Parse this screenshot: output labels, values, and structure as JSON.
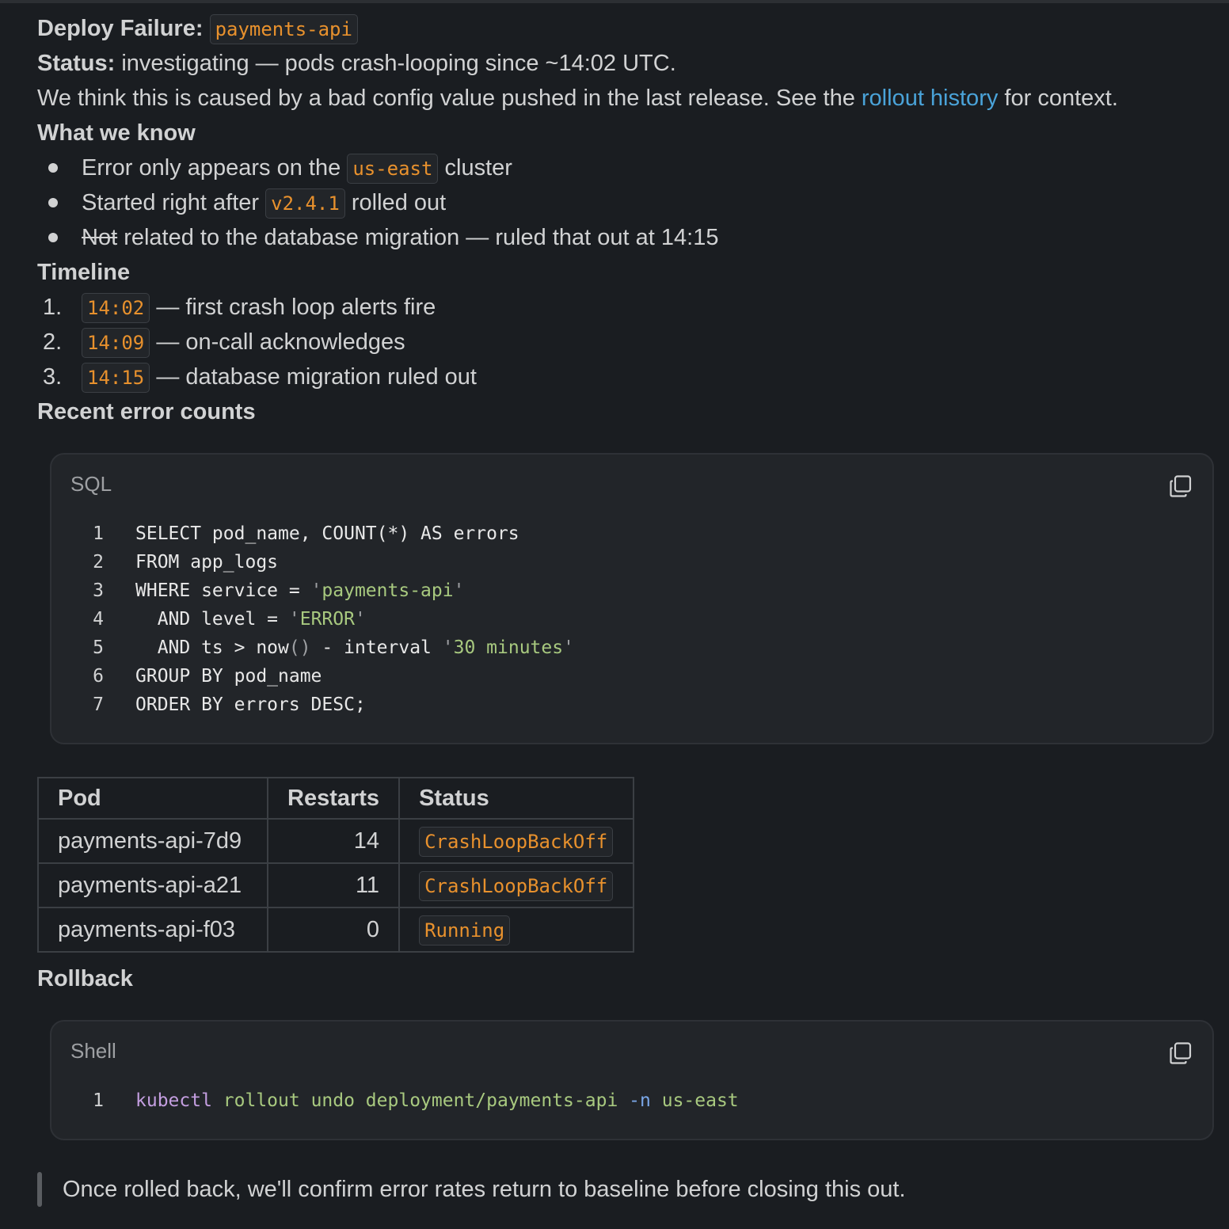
{
  "title": {
    "label": "Deploy Failure:",
    "service": "payments-api"
  },
  "status": {
    "label": "Status:",
    "text": "investigating — pods crash-looping since ~14:02 UTC."
  },
  "intro": {
    "before": "We think this is caused by a bad config value pushed in the last release. See the",
    "link": "rollout history",
    "after": "for context."
  },
  "what_we_know": {
    "heading": "What we know",
    "items": [
      {
        "before": "Error only appears on the",
        "code": "us-east",
        "after": "cluster"
      },
      {
        "before": "Started right after",
        "code": "v2.4.1",
        "after": "rolled out"
      },
      {
        "strike": "Not",
        "after": "related to the database migration — ruled that out at 14:15"
      }
    ]
  },
  "timeline": {
    "heading": "Timeline",
    "items": [
      {
        "num": "1.",
        "time": "14:02",
        "text": "— first crash loop alerts fire"
      },
      {
        "num": "2.",
        "time": "14:09",
        "text": "— on-call acknowledges"
      },
      {
        "num": "3.",
        "time": "14:15",
        "text": "— database migration ruled out"
      }
    ]
  },
  "recent_errors": {
    "heading": "Recent error counts"
  },
  "sql_block": {
    "language": "SQL",
    "line_numbers": [
      "1",
      "2",
      "3",
      "4",
      "5",
      "6",
      "7"
    ],
    "lines": [
      [
        {
          "t": "SELECT pod_name, COUNT(*) AS errors",
          "c": ""
        }
      ],
      [
        {
          "t": "FROM app_logs",
          "c": ""
        }
      ],
      [
        {
          "t": "WHERE service = ",
          "c": ""
        },
        {
          "t": "'",
          "c": "dim"
        },
        {
          "t": "payments-api",
          "c": "str"
        },
        {
          "t": "'",
          "c": "dim"
        }
      ],
      [
        {
          "t": "  AND level = ",
          "c": ""
        },
        {
          "t": "'",
          "c": "dim"
        },
        {
          "t": "ERROR",
          "c": "str"
        },
        {
          "t": "'",
          "c": "dim"
        }
      ],
      [
        {
          "t": "  AND ts > now",
          "c": ""
        },
        {
          "t": "()",
          "c": "dim"
        },
        {
          "t": " - interval ",
          "c": ""
        },
        {
          "t": "'",
          "c": "dim"
        },
        {
          "t": "30 minutes",
          "c": "str"
        },
        {
          "t": "'",
          "c": "dim"
        }
      ],
      [
        {
          "t": "GROUP BY pod_name",
          "c": ""
        }
      ],
      [
        {
          "t": "ORDER BY errors DESC;",
          "c": ""
        }
      ]
    ]
  },
  "pods_table": {
    "headers": [
      "Pod",
      "Restarts",
      "Status"
    ],
    "rows": [
      {
        "pod": "payments-api-7d9",
        "restarts": "14",
        "status": "CrashLoopBackOff"
      },
      {
        "pod": "payments-api-a21",
        "restarts": "11",
        "status": "CrashLoopBackOff"
      },
      {
        "pod": "payments-api-f03",
        "restarts": "0",
        "status": "Running"
      }
    ]
  },
  "rollback": {
    "heading": "Rollback"
  },
  "shell_block": {
    "language": "Shell",
    "line_numbers": [
      "1"
    ],
    "lines": [
      [
        {
          "t": "kubectl",
          "c": "kw-purple"
        },
        {
          "t": " ",
          "c": ""
        },
        {
          "t": "rollout undo deployment/payments-api",
          "c": "str"
        },
        {
          "t": " ",
          "c": ""
        },
        {
          "t": "-n",
          "c": "kw-flag"
        },
        {
          "t": " ",
          "c": ""
        },
        {
          "t": "us-east",
          "c": "str"
        }
      ]
    ]
  },
  "quote": {
    "text": "Once rolled back, we'll confirm error rates return to baseline before closing this out."
  },
  "icons": {
    "copy": "copy-icon"
  },
  "colors": {
    "background": "#1a1d21",
    "text": "#d1d2d3",
    "link": "#4aa3d9",
    "inline_code": "#e8912d",
    "string": "#a8c97f",
    "keyword": "#c49ee0",
    "flag": "#7aa7e8"
  }
}
